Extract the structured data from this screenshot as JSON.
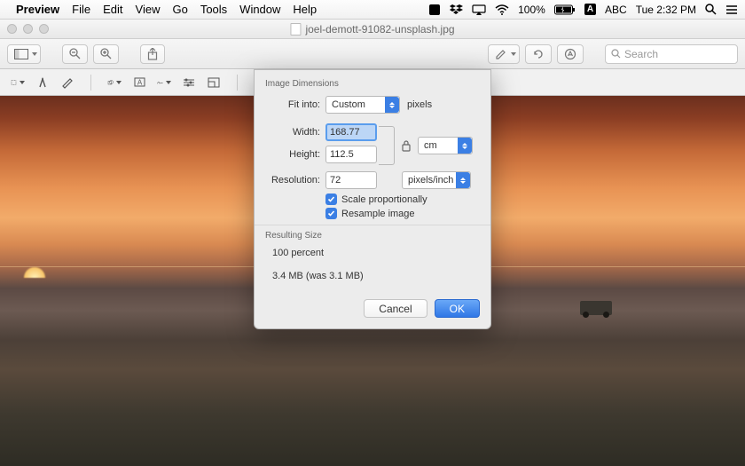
{
  "menubar": {
    "app": "Preview",
    "items": [
      "File",
      "Edit",
      "View",
      "Go",
      "Tools",
      "Window",
      "Help"
    ],
    "battery": "100%",
    "input_abc": "ABC",
    "clock": "Tue 2:32 PM"
  },
  "titlebar": {
    "filename": "joel-demott-91082-unsplash.jpg"
  },
  "toolbar": {
    "search_placeholder": "Search"
  },
  "dialog": {
    "section1_title": "Image Dimensions",
    "fit_into_label": "Fit into:",
    "fit_into_value": "Custom",
    "fit_into_unit": "pixels",
    "width_label": "Width:",
    "width_value": "168.77",
    "height_label": "Height:",
    "height_value": "112.5",
    "wh_unit": "cm",
    "resolution_label": "Resolution:",
    "resolution_value": "72",
    "resolution_unit": "pixels/inch",
    "scale_label": "Scale proportionally",
    "resample_label": "Resample image",
    "section2_title": "Resulting Size",
    "percent_line": "100 percent",
    "size_line": "3.4 MB (was 3.1 MB)",
    "cancel": "Cancel",
    "ok": "OK"
  }
}
